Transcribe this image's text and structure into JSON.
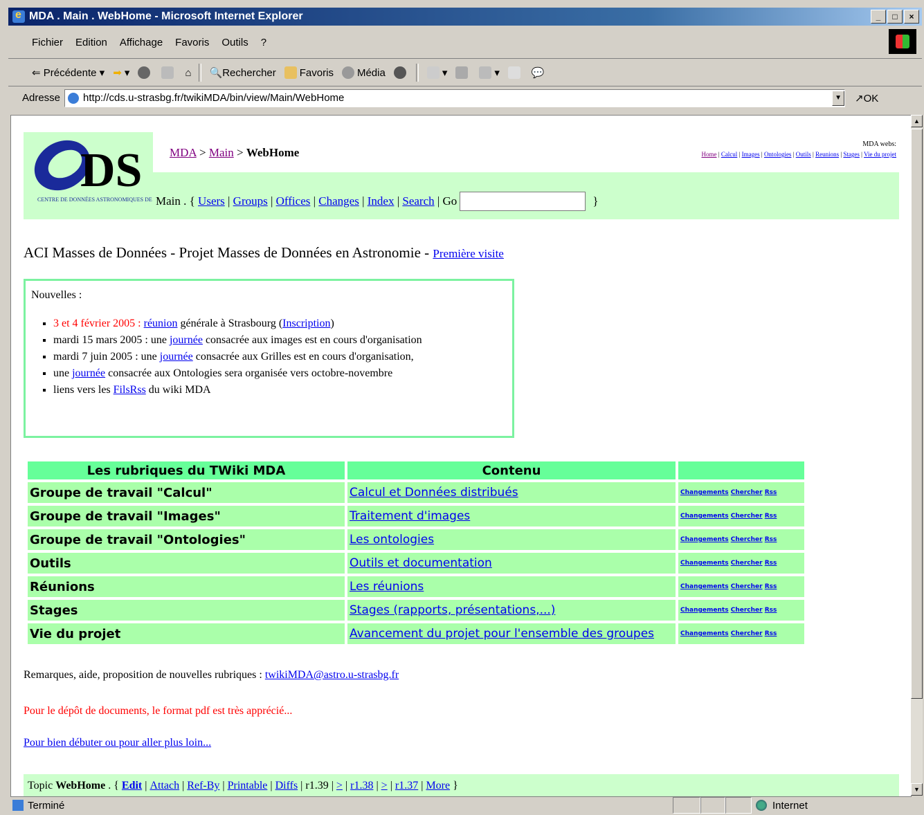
{
  "window": {
    "title": "MDA . Main . WebHome - Microsoft Internet Explorer",
    "controls": [
      "_",
      "□",
      "×"
    ]
  },
  "menu": [
    "Fichier",
    "Edition",
    "Affichage",
    "Favoris",
    "Outils",
    "?"
  ],
  "toolbar": {
    "back": "Précédente",
    "search": "Rechercher",
    "favorites": "Favoris",
    "media": "Média"
  },
  "address": {
    "label": "Adresse",
    "url": "http://cds.u-strasbg.fr/twikiMDA/bin/view/Main/WebHome",
    "go": "OK"
  },
  "page": {
    "logo_text": "CENTRE DE DONNÉES ASTRONOMIQUES DE STRASBOURG",
    "breadcrumb": {
      "web": "MDA",
      "main": "Main",
      "sep": ">",
      "topic": "WebHome"
    },
    "mda_webs": {
      "title": "MDA webs:",
      "links": [
        "Home",
        "Calcul",
        "Images",
        "Ontologies",
        "Outils",
        "Reunions",
        "Stages",
        "Vie du projet"
      ]
    },
    "main_nav": {
      "prefix": "Main . {",
      "links": [
        "Users",
        "Groups",
        "Offices",
        "Changes",
        "Index",
        "Search"
      ],
      "go": "Go",
      "suffix": "}"
    },
    "title": "ACI Masses de Données - Projet Masses de Données en Astronomie -",
    "first_visit": "Première visite",
    "news": {
      "heading": "Nouvelles :",
      "items": [
        {
          "parts": [
            [
              "red",
              "3 et 4 février 2005 : "
            ],
            [
              "link",
              "réunion"
            ],
            [
              "text",
              " générale à Strasbourg ("
            ],
            [
              "link",
              "Inscription"
            ],
            [
              "text",
              ")"
            ]
          ]
        },
        {
          "parts": [
            [
              "text",
              "mardi 15 mars 2005 : une "
            ],
            [
              "link",
              "journée"
            ],
            [
              "text",
              " consacrée aux images est en cours d'organisation"
            ]
          ]
        },
        {
          "parts": [
            [
              "text",
              "mardi 7 juin 2005 : une "
            ],
            [
              "link",
              "journée"
            ],
            [
              "text",
              " consacrée aux Grilles est en cours d'organisation,"
            ]
          ]
        },
        {
          "parts": [
            [
              "text",
              "une "
            ],
            [
              "link",
              "journée"
            ],
            [
              "text",
              " consacrée aux Ontologies sera organisée vers octobre-novembre"
            ]
          ]
        },
        {
          "parts": [
            [
              "text",
              "liens vers les "
            ],
            [
              "link",
              "FilsRss"
            ],
            [
              "text",
              " du wiki MDA"
            ]
          ]
        }
      ]
    },
    "table": {
      "headers": [
        "Les rubriques du TWiki MDA",
        "Contenu",
        ""
      ],
      "rows": [
        {
          "name": "Groupe de travail \"Calcul\"",
          "content": "Calcul et Données distribués"
        },
        {
          "name": "Groupe de travail \"Images\"",
          "content": "Traitement d'images"
        },
        {
          "name": "Groupe de travail \"Ontologies\"",
          "content": "Les ontologies"
        },
        {
          "name": "Outils",
          "content": "Outils et documentation"
        },
        {
          "name": "Réunions",
          "content": "Les réunions"
        },
        {
          "name": "Stages",
          "content": "Stages (rapports, présentations,...)"
        },
        {
          "name": "Vie du projet",
          "content": "Avancement du projet pour l'ensemble des groupes"
        }
      ],
      "actions": [
        "Changements",
        "Chercher",
        "Rss"
      ]
    },
    "remarks_label": "Remarques, aide, proposition de nouvelles rubriques : ",
    "remarks_email": "twikiMDA@astro.u-strasbg.fr",
    "depot": "Pour le dépôt de documents, le format pdf est très apprécié...",
    "debut": "Pour bien débuter ou pour aller plus loin...",
    "topic_bar": {
      "prefix": "Topic",
      "topic": "WebHome",
      "open": ". {",
      "edit": "Edit",
      "links": [
        "Attach",
        "Ref-By",
        "Printable",
        "Diffs"
      ],
      "rev": "r1.39",
      "revlinks": [
        ">",
        "r1.38",
        ">",
        "r1.37",
        "More"
      ],
      "close": "}"
    }
  },
  "status": {
    "text": "Terminé",
    "zone": "Internet"
  }
}
